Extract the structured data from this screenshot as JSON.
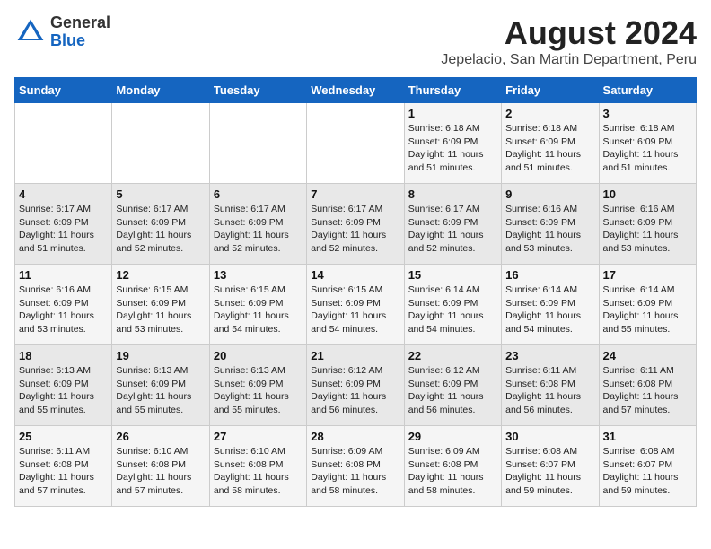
{
  "header": {
    "logo_general": "General",
    "logo_blue": "Blue",
    "title": "August 2024",
    "subtitle": "Jepelacio, San Martin Department, Peru"
  },
  "weekdays": [
    "Sunday",
    "Monday",
    "Tuesday",
    "Wednesday",
    "Thursday",
    "Friday",
    "Saturday"
  ],
  "weeks": [
    [
      {
        "day": "",
        "info": ""
      },
      {
        "day": "",
        "info": ""
      },
      {
        "day": "",
        "info": ""
      },
      {
        "day": "",
        "info": ""
      },
      {
        "day": "1",
        "info": "Sunrise: 6:18 AM\nSunset: 6:09 PM\nDaylight: 11 hours\nand 51 minutes."
      },
      {
        "day": "2",
        "info": "Sunrise: 6:18 AM\nSunset: 6:09 PM\nDaylight: 11 hours\nand 51 minutes."
      },
      {
        "day": "3",
        "info": "Sunrise: 6:18 AM\nSunset: 6:09 PM\nDaylight: 11 hours\nand 51 minutes."
      }
    ],
    [
      {
        "day": "4",
        "info": "Sunrise: 6:17 AM\nSunset: 6:09 PM\nDaylight: 11 hours\nand 51 minutes."
      },
      {
        "day": "5",
        "info": "Sunrise: 6:17 AM\nSunset: 6:09 PM\nDaylight: 11 hours\nand 52 minutes."
      },
      {
        "day": "6",
        "info": "Sunrise: 6:17 AM\nSunset: 6:09 PM\nDaylight: 11 hours\nand 52 minutes."
      },
      {
        "day": "7",
        "info": "Sunrise: 6:17 AM\nSunset: 6:09 PM\nDaylight: 11 hours\nand 52 minutes."
      },
      {
        "day": "8",
        "info": "Sunrise: 6:17 AM\nSunset: 6:09 PM\nDaylight: 11 hours\nand 52 minutes."
      },
      {
        "day": "9",
        "info": "Sunrise: 6:16 AM\nSunset: 6:09 PM\nDaylight: 11 hours\nand 53 minutes."
      },
      {
        "day": "10",
        "info": "Sunrise: 6:16 AM\nSunset: 6:09 PM\nDaylight: 11 hours\nand 53 minutes."
      }
    ],
    [
      {
        "day": "11",
        "info": "Sunrise: 6:16 AM\nSunset: 6:09 PM\nDaylight: 11 hours\nand 53 minutes."
      },
      {
        "day": "12",
        "info": "Sunrise: 6:15 AM\nSunset: 6:09 PM\nDaylight: 11 hours\nand 53 minutes."
      },
      {
        "day": "13",
        "info": "Sunrise: 6:15 AM\nSunset: 6:09 PM\nDaylight: 11 hours\nand 54 minutes."
      },
      {
        "day": "14",
        "info": "Sunrise: 6:15 AM\nSunset: 6:09 PM\nDaylight: 11 hours\nand 54 minutes."
      },
      {
        "day": "15",
        "info": "Sunrise: 6:14 AM\nSunset: 6:09 PM\nDaylight: 11 hours\nand 54 minutes."
      },
      {
        "day": "16",
        "info": "Sunrise: 6:14 AM\nSunset: 6:09 PM\nDaylight: 11 hours\nand 54 minutes."
      },
      {
        "day": "17",
        "info": "Sunrise: 6:14 AM\nSunset: 6:09 PM\nDaylight: 11 hours\nand 55 minutes."
      }
    ],
    [
      {
        "day": "18",
        "info": "Sunrise: 6:13 AM\nSunset: 6:09 PM\nDaylight: 11 hours\nand 55 minutes."
      },
      {
        "day": "19",
        "info": "Sunrise: 6:13 AM\nSunset: 6:09 PM\nDaylight: 11 hours\nand 55 minutes."
      },
      {
        "day": "20",
        "info": "Sunrise: 6:13 AM\nSunset: 6:09 PM\nDaylight: 11 hours\nand 55 minutes."
      },
      {
        "day": "21",
        "info": "Sunrise: 6:12 AM\nSunset: 6:09 PM\nDaylight: 11 hours\nand 56 minutes."
      },
      {
        "day": "22",
        "info": "Sunrise: 6:12 AM\nSunset: 6:09 PM\nDaylight: 11 hours\nand 56 minutes."
      },
      {
        "day": "23",
        "info": "Sunrise: 6:11 AM\nSunset: 6:08 PM\nDaylight: 11 hours\nand 56 minutes."
      },
      {
        "day": "24",
        "info": "Sunrise: 6:11 AM\nSunset: 6:08 PM\nDaylight: 11 hours\nand 57 minutes."
      }
    ],
    [
      {
        "day": "25",
        "info": "Sunrise: 6:11 AM\nSunset: 6:08 PM\nDaylight: 11 hours\nand 57 minutes."
      },
      {
        "day": "26",
        "info": "Sunrise: 6:10 AM\nSunset: 6:08 PM\nDaylight: 11 hours\nand 57 minutes."
      },
      {
        "day": "27",
        "info": "Sunrise: 6:10 AM\nSunset: 6:08 PM\nDaylight: 11 hours\nand 58 minutes."
      },
      {
        "day": "28",
        "info": "Sunrise: 6:09 AM\nSunset: 6:08 PM\nDaylight: 11 hours\nand 58 minutes."
      },
      {
        "day": "29",
        "info": "Sunrise: 6:09 AM\nSunset: 6:08 PM\nDaylight: 11 hours\nand 58 minutes."
      },
      {
        "day": "30",
        "info": "Sunrise: 6:08 AM\nSunset: 6:07 PM\nDaylight: 11 hours\nand 59 minutes."
      },
      {
        "day": "31",
        "info": "Sunrise: 6:08 AM\nSunset: 6:07 PM\nDaylight: 11 hours\nand 59 minutes."
      }
    ]
  ]
}
